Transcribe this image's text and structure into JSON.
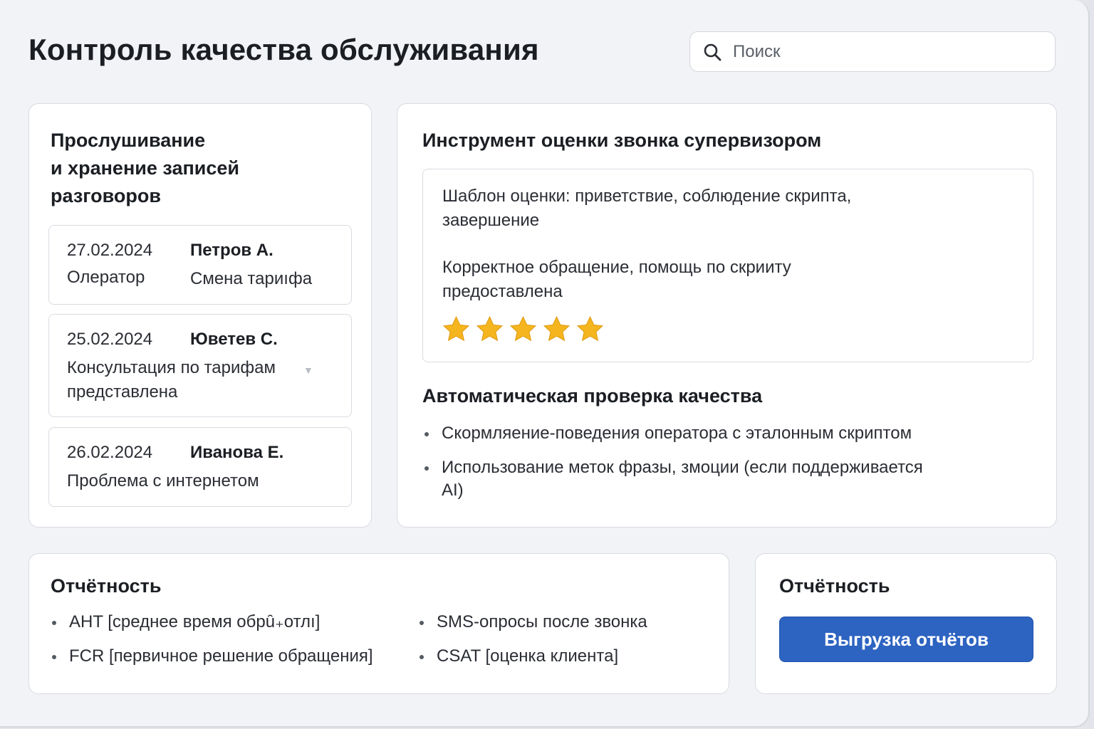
{
  "header": {
    "title": "Контроль качества обслуживания",
    "search_placeholder": "Поиск"
  },
  "recordings": {
    "title_lines": [
      "Прослушивание",
      "и хранение записей",
      "разговоров"
    ],
    "items": [
      {
        "date": "27.02.2024",
        "name": "Петров А.",
        "desc": "Олератор",
        "topic": "Смена тариıфа"
      },
      {
        "date": "25.02.2024",
        "name": "Юветев С.",
        "desc_lines": [
          "Консультация по тарифам",
          "представлена"
        ]
      },
      {
        "date": "26.02.2024",
        "name": "Иванова Е.",
        "desc": "Проблема с интернетом"
      }
    ]
  },
  "evaluation": {
    "title": "Инструмент оценки звонка супервизором",
    "template_lines": [
      "Шаблон оценки: приветствие, соблюдение скрипта,",
      "завершение"
    ],
    "comment_lines": [
      "Корректное обращение, помощь по скрииту",
      "предоставлена"
    ],
    "rating": 5,
    "rating_max": 5,
    "star_color": "#f5b51f"
  },
  "auto_check": {
    "title": "Автоматическая проверка качества",
    "items": [
      "Скормляение-поведения оператора с эталонным скриптом",
      "Использование меток  фразы, змоции (если поддерживается",
      "AI)"
    ]
  },
  "reporting": {
    "title": "Отчётность",
    "left_items": [
      "AHT [среднее время обрȗ₊отлı]",
      "FCR [первичное решение обращения]"
    ],
    "right_items": [
      "SMS-опросы после  звонка",
      "CSAT [оценка клиента]"
    ]
  },
  "export": {
    "title": "Отчётность",
    "button_label": "Выгрузка отчётов",
    "button_color": "#2d63c1"
  }
}
